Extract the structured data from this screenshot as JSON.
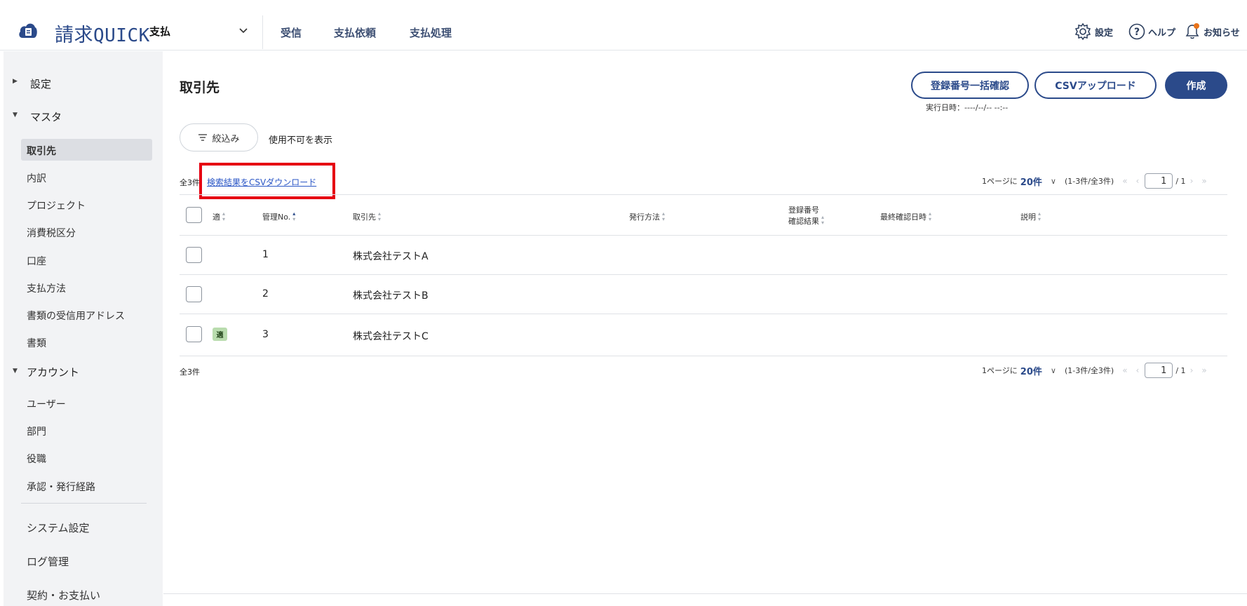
{
  "header": {
    "brand_kanji": "請求",
    "brand_latin": "QUICK",
    "mode": "支払",
    "tabs": [
      "受信",
      "支払依頼",
      "支払処理"
    ],
    "settings_label": "設定",
    "help_label": "ヘルプ",
    "notice_label": "お知らせ"
  },
  "sidebar": {
    "settings_label": "設定",
    "master_label": "マスタ",
    "master_items": [
      "取引先",
      "内訳",
      "プロジェクト",
      "消費税区分",
      "口座",
      "支払方法",
      "書類の受信用アドレス",
      "書類"
    ],
    "account_label": "アカウント",
    "account_items": [
      "ユーザー",
      "部門",
      "役職",
      "承認・発行経路"
    ],
    "system_items": [
      "システム設定",
      "ログ管理",
      "契約・お支払い"
    ]
  },
  "page": {
    "title": "取引先",
    "bulk_check_label": "登録番号一括確認",
    "csv_upload_label": "CSVアップロード",
    "create_label": "作成",
    "exec_time": "実行日時：----/--/-- --:--",
    "filter_label": "絞込み",
    "show_disabled_label": "使用不可を表示",
    "total_count": "全3件",
    "csv_download_label": "検索結果をCSVダウンロード"
  },
  "pager": {
    "prefix": "1ページに",
    "size": "20件",
    "range": "(1-3件/全3件)",
    "first": "«",
    "prev": "‹",
    "page": "1",
    "total": "/ 1",
    "next": "›",
    "last": "»"
  },
  "table": {
    "headers": {
      "col_tekikaku": "適",
      "col_no": "管理No.",
      "col_partner": "取引先",
      "col_method": "発行方法",
      "col_reg_line1": "登録番号",
      "col_reg_line2": "確認結果",
      "col_last": "最終確認日時",
      "col_desc": "説明"
    },
    "rows": [
      {
        "no": "1",
        "partner": "株式会社テストA",
        "badge": ""
      },
      {
        "no": "2",
        "partner": "株式会社テストB",
        "badge": ""
      },
      {
        "no": "3",
        "partner": "株式会社テストC",
        "badge": "適"
      }
    ]
  },
  "colors": {
    "brand": "#2b4a8a",
    "link": "#2a56c6",
    "highlight": "#e60012",
    "badge_bg": "#b9dcae"
  }
}
